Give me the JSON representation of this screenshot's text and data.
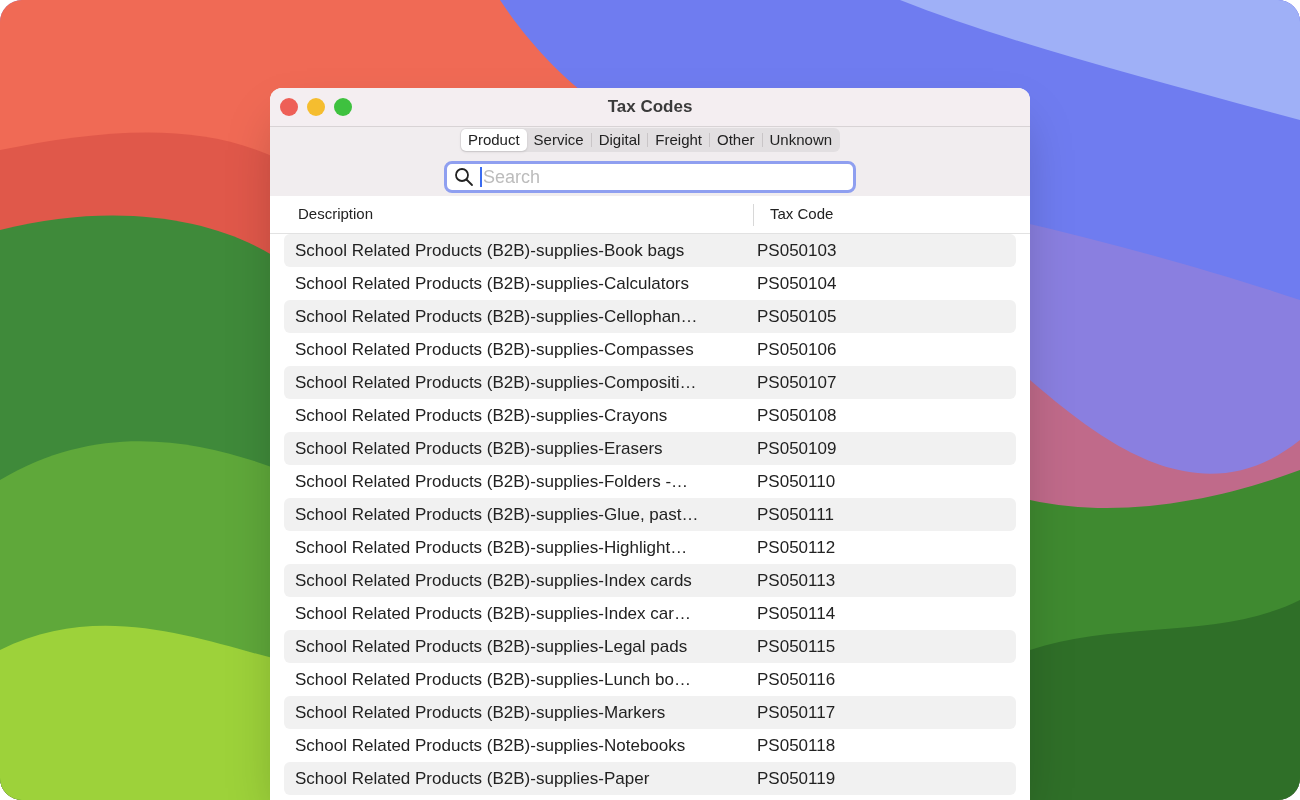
{
  "window": {
    "title": "Tax Codes"
  },
  "tabs": [
    {
      "label": "Product",
      "selected": true
    },
    {
      "label": "Service",
      "selected": false
    },
    {
      "label": "Digital",
      "selected": false
    },
    {
      "label": "Freight",
      "selected": false
    },
    {
      "label": "Other",
      "selected": false
    },
    {
      "label": "Unknown",
      "selected": false
    }
  ],
  "search": {
    "placeholder": "Search"
  },
  "table": {
    "columns": [
      "Description",
      "Tax Code"
    ],
    "rows": [
      {
        "description": "School Related Products (B2B)-supplies-Book bags",
        "tax_code": "PS050103"
      },
      {
        "description": "School Related Products (B2B)-supplies-Calculators",
        "tax_code": "PS050104"
      },
      {
        "description": "School Related Products (B2B)-supplies-Cellophan…",
        "tax_code": "PS050105"
      },
      {
        "description": "School Related Products (B2B)-supplies-Compasses",
        "tax_code": "PS050106"
      },
      {
        "description": "School Related Products (B2B)-supplies-Compositi…",
        "tax_code": "PS050107"
      },
      {
        "description": "School Related Products (B2B)-supplies-Crayons",
        "tax_code": "PS050108"
      },
      {
        "description": "School Related Products (B2B)-supplies-Erasers",
        "tax_code": "PS050109"
      },
      {
        "description": "School Related Products (B2B)-supplies-Folders -…",
        "tax_code": "PS050110"
      },
      {
        "description": "School Related Products (B2B)-supplies-Glue, past…",
        "tax_code": "PS050111"
      },
      {
        "description": "School Related Products (B2B)-supplies-Highlight…",
        "tax_code": "PS050112"
      },
      {
        "description": "School Related Products (B2B)-supplies-Index cards",
        "tax_code": "PS050113"
      },
      {
        "description": "School Related Products (B2B)-supplies-Index car…",
        "tax_code": "PS050114"
      },
      {
        "description": "School Related Products (B2B)-supplies-Legal pads",
        "tax_code": "PS050115"
      },
      {
        "description": "School Related Products (B2B)-supplies-Lunch bo…",
        "tax_code": "PS050116"
      },
      {
        "description": "School Related Products (B2B)-supplies-Markers",
        "tax_code": "PS050117"
      },
      {
        "description": "School Related Products (B2B)-supplies-Notebooks",
        "tax_code": "PS050118"
      },
      {
        "description": "School Related Products (B2B)-supplies-Paper",
        "tax_code": "PS050119"
      }
    ]
  }
}
